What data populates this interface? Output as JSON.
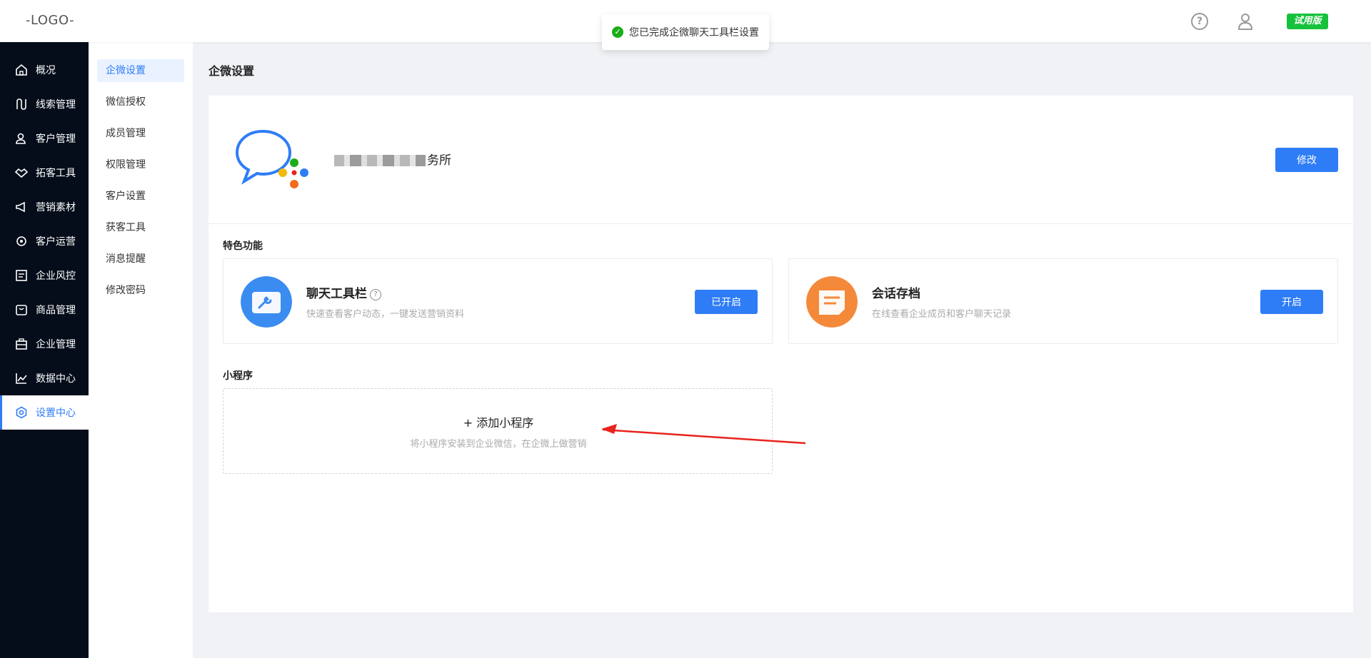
{
  "header": {
    "logo": "-LOGO-",
    "trial_badge": "试用版"
  },
  "toast": {
    "message": "您已完成企微聊天工具栏设置"
  },
  "nav": {
    "items": [
      {
        "label": "概况",
        "icon": "home-icon"
      },
      {
        "label": "线索管理",
        "icon": "route-icon"
      },
      {
        "label": "客户管理",
        "icon": "customers-icon"
      },
      {
        "label": "拓客工具",
        "icon": "handshake-icon"
      },
      {
        "label": "营销素材",
        "icon": "megaphone-icon"
      },
      {
        "label": "客户运营",
        "icon": "operation-icon"
      },
      {
        "label": "企业风控",
        "icon": "risk-icon"
      },
      {
        "label": "商品管理",
        "icon": "goods-icon"
      },
      {
        "label": "企业管理",
        "icon": "briefcase-icon"
      },
      {
        "label": "数据中心",
        "icon": "chart-icon"
      },
      {
        "label": "设置中心",
        "icon": "settings-icon"
      }
    ],
    "active_index": 10
  },
  "submenu": {
    "items": [
      "企微设置",
      "微信授权",
      "成员管理",
      "权限管理",
      "客户设置",
      "获客工具",
      "消息提醒",
      "修改密码"
    ],
    "active_index": 0
  },
  "main": {
    "title": "企微设置",
    "corp": {
      "name_suffix": "务所",
      "edit_label": "修改"
    },
    "features_title": "特色功能",
    "features": [
      {
        "name": "聊天工具栏",
        "desc": "快速查看客户动态，一键发送营销资料",
        "button": "已开启",
        "has_help": true
      },
      {
        "name": "会话存档",
        "desc": "在线查看企业成员和客户聊天记录",
        "button": "开启",
        "has_help": false
      }
    ],
    "mini_program": {
      "title": "小程序",
      "add_label": "添加小程序",
      "plus": "+",
      "desc": "将小程序安装到企业微信，在企微上做营销"
    }
  },
  "colors": {
    "primary": "#2f7df6",
    "nav_bg": "#050d1a",
    "trial_green": "#16c23b",
    "arrow_red": "#e8231d"
  }
}
